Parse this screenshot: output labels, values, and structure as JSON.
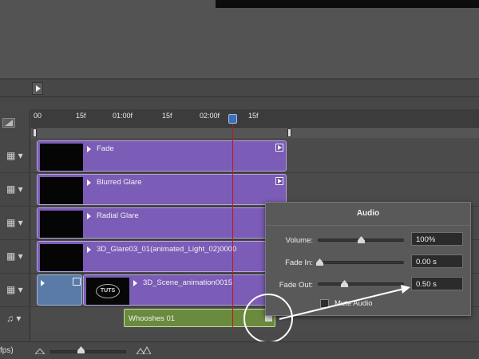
{
  "timeline": {
    "ruler": {
      "ticks": [
        "00",
        "15f",
        "01:00f",
        "15f",
        "02:00f",
        "15f"
      ]
    },
    "tracks": [
      {
        "name": "Fade",
        "icon": "film-icon"
      },
      {
        "name": "Blurred Glare",
        "icon": "film-icon"
      },
      {
        "name": "Radial Glare",
        "icon": "film-icon"
      },
      {
        "name": "3D_Glare03_01(animated_Light_02)0000",
        "icon": "film-icon"
      },
      {
        "name": "3D_Scene_animation0015",
        "icon": "film-icon",
        "thumb_text": "TUTS"
      }
    ],
    "audio_track": {
      "clip_name": "Whooshes 01",
      "icon": "music-note-icon"
    }
  },
  "audio_panel": {
    "title": "Audio",
    "volume_label": "Volume:",
    "volume_value": "100%",
    "volume_level": 0.5,
    "fade_in_label": "Fade In:",
    "fade_in_value": "0.00 s",
    "fade_out_label": "Fade Out:",
    "fade_out_value": "0.50 s",
    "mute_label": "Mute Audio",
    "mute_checked": false
  },
  "bottom": {
    "fps_label": "fps)"
  },
  "colors": {
    "clip_purple": "#7b5cb6",
    "audio_green": "#6a8a3e",
    "playhead_red": "#c0181b",
    "playhead_blue": "#3f6fb5"
  }
}
